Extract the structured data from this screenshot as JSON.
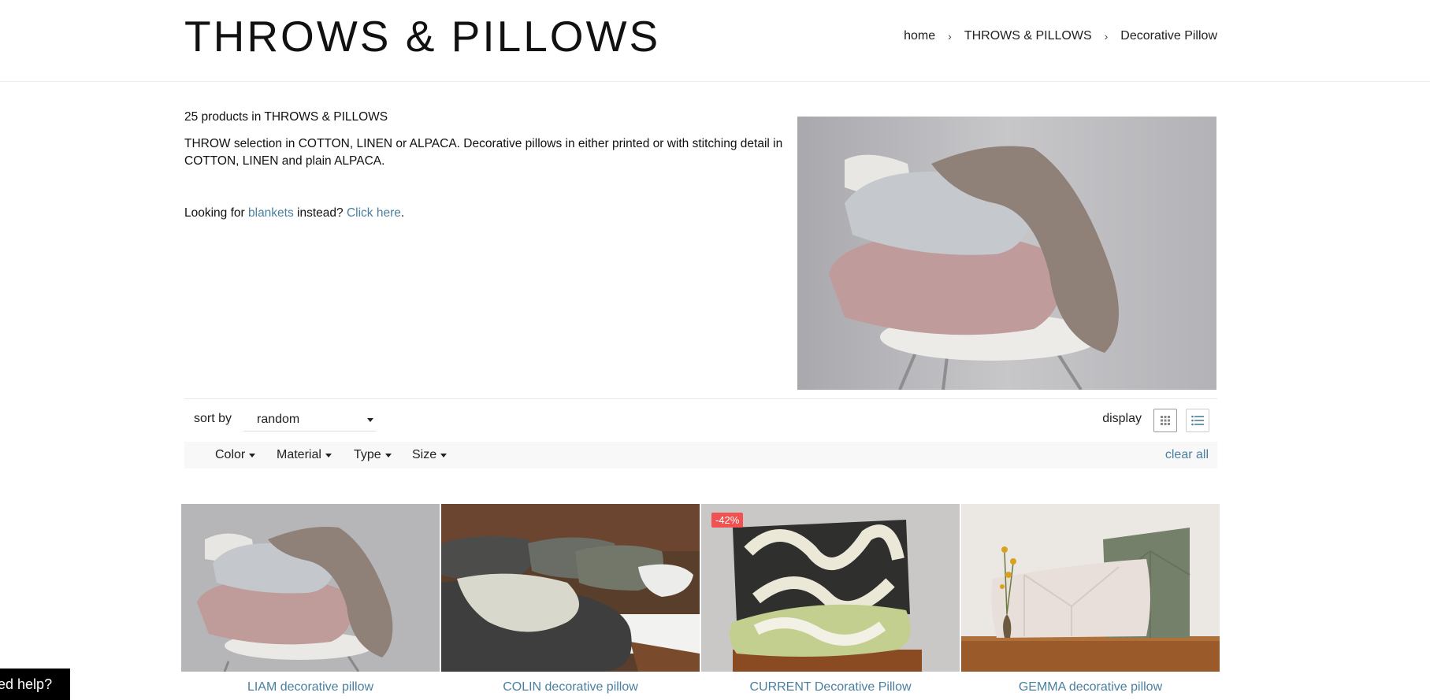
{
  "header": {
    "title": "THROWS & PILLOWS",
    "breadcrumb": [
      "home",
      "THROWS & PILLOWS",
      "Decorative Pillow"
    ]
  },
  "intro": {
    "count_text": "25 products in THROWS & PILLOWS",
    "description": "THROW selection in COTTON, LINEN or ALPACA. Decorative pillows in either printed or with stitching detail in COTTON, LINEN and plain ALPACA.",
    "looking_prefix": "Looking for ",
    "blankets_link": "blankets",
    "instead": " instead? ",
    "click_here": "Click here",
    "period": "."
  },
  "toolbar": {
    "sort_label": "sort by",
    "sort_value": "random",
    "display_label": "display"
  },
  "filters": {
    "items": [
      "Color",
      "Material",
      "Type",
      "Size"
    ],
    "clear_all": "clear all"
  },
  "products": [
    {
      "name": "LIAM decorative pillow",
      "badge": ""
    },
    {
      "name": "COLIN decorative pillow",
      "badge": ""
    },
    {
      "name": "CURRENT Decorative Pillow",
      "badge": "-42%"
    },
    {
      "name": "GEMMA decorative pillow",
      "badge": ""
    }
  ],
  "help": {
    "label": "Need help?"
  },
  "colors": {
    "link": "#4a7fa0",
    "badge": "#f05252"
  }
}
